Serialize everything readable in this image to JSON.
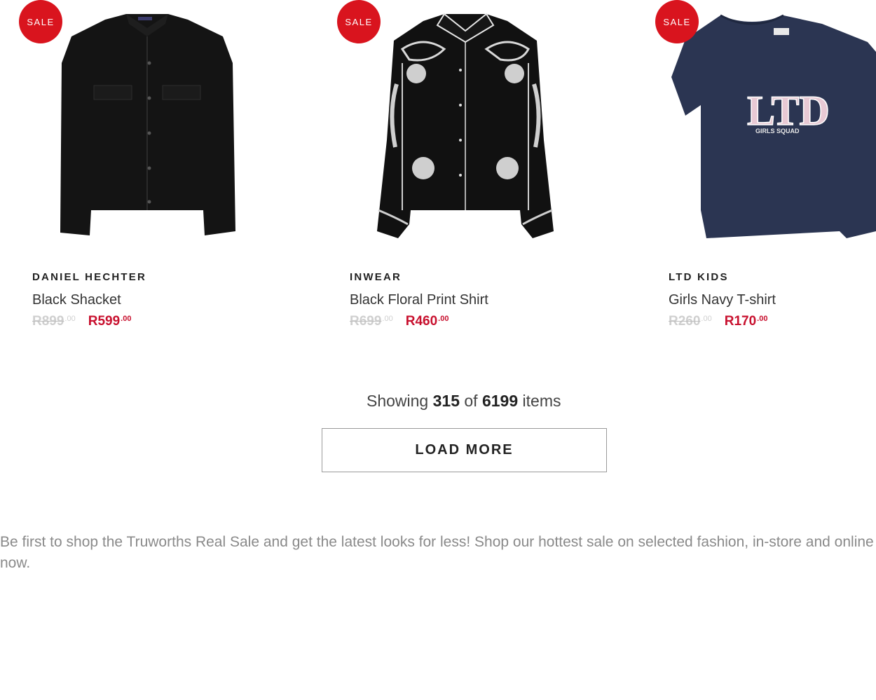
{
  "products": [
    {
      "badge": "SALE",
      "brand": "DANIEL HECHTER",
      "name": "Black Shacket",
      "old_price": "R899",
      "old_cents": ".00",
      "new_price": "R599",
      "new_cents": ".00",
      "image_icon": "black-shacket-image"
    },
    {
      "badge": "SALE",
      "brand": "INWEAR",
      "name": "Black Floral Print Shirt",
      "old_price": "R699",
      "old_cents": ".00",
      "new_price": "R460",
      "new_cents": ".00",
      "image_icon": "black-floral-shirt-image"
    },
    {
      "badge": "SALE",
      "brand": "LTD KIDS",
      "name": "Girls Navy T-shirt",
      "old_price": "R260",
      "old_cents": ".00",
      "new_price": "R170",
      "new_cents": ".00",
      "image_icon": "girls-navy-tshirt-image",
      "print_text": "LTD",
      "print_subtext": "GIRLS SQUAD"
    }
  ],
  "pagination": {
    "showing_label": "Showing",
    "shown_count": "315",
    "of_label": "of",
    "total_count": "6199",
    "items_label": "items",
    "load_more_label": "LOAD MORE"
  },
  "seo_text": {
    "line1": "Be first to shop the Truworths Real Sale and get the latest looks for less! Shop our hottest sale on selected fashion, in-store and online",
    "line2": "now."
  },
  "colors": {
    "sale_red": "#d9141e",
    "price_red": "#c8102e",
    "old_price_grey": "#cfcfcf",
    "navy": "#2b3552"
  }
}
